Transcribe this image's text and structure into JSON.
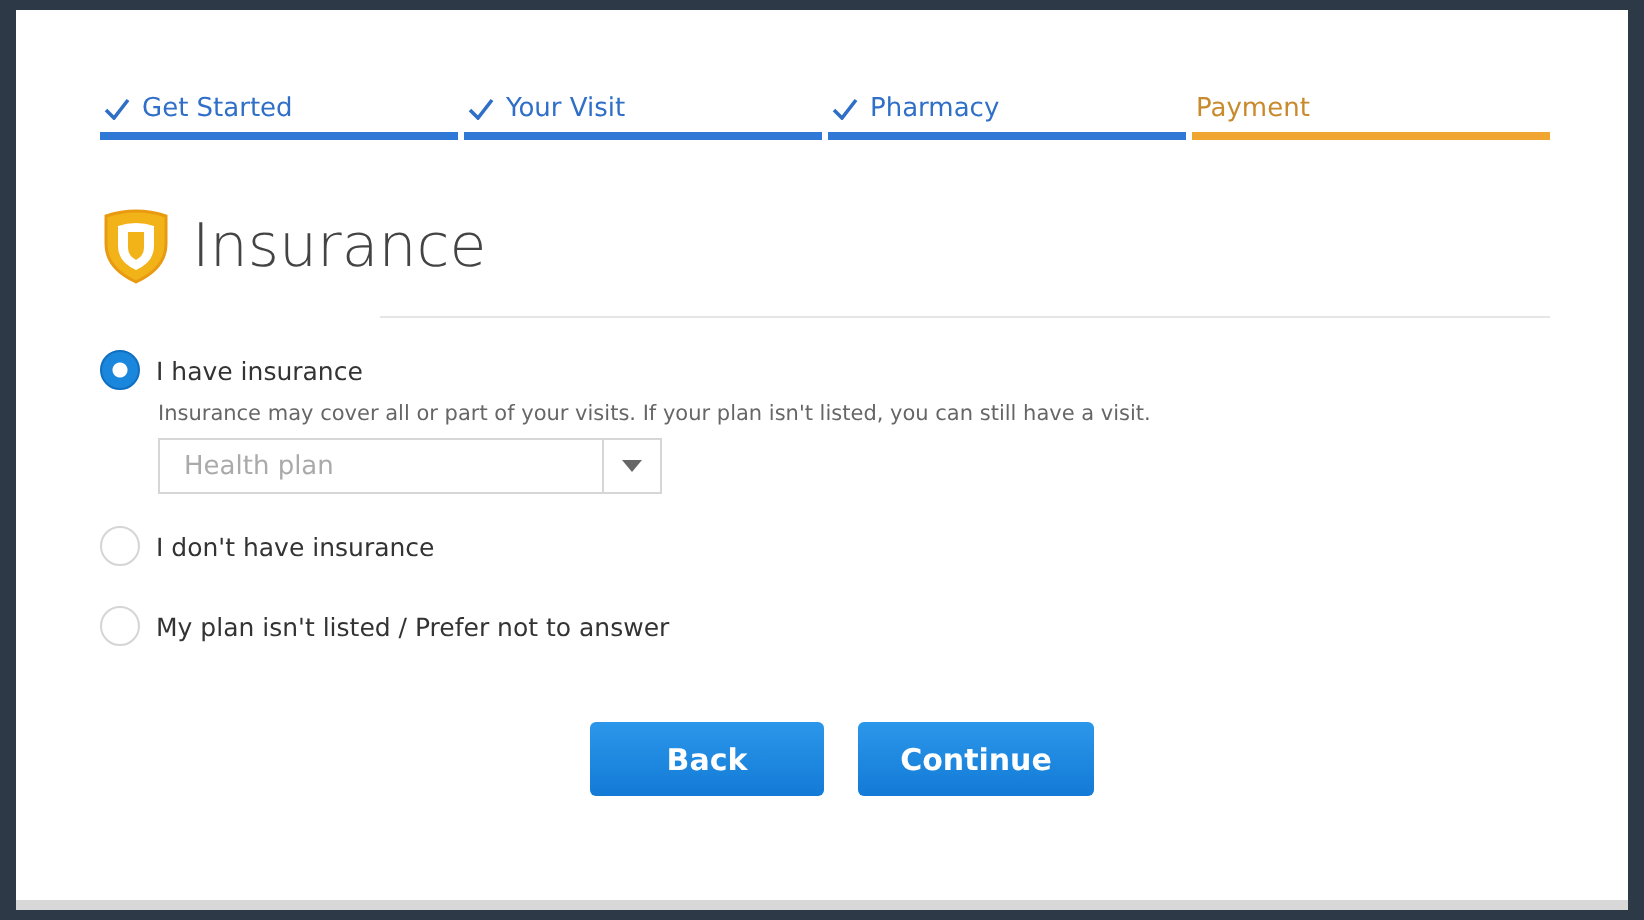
{
  "steps": [
    {
      "label": "Get Started",
      "completed": true,
      "selected": false
    },
    {
      "label": "Your Visit",
      "completed": true,
      "selected": false
    },
    {
      "label": "Pharmacy",
      "completed": true,
      "selected": false
    },
    {
      "label": "Payment",
      "completed": false,
      "selected": true
    }
  ],
  "heading": "Insurance",
  "options": [
    {
      "label": "I have insurance",
      "selected": true,
      "description": "Insurance may cover all or part of your visits. If your plan isn't listed, you can still have a visit.",
      "dropdown": {
        "placeholder": "Health plan"
      }
    },
    {
      "label": "I don't have insurance",
      "selected": false
    },
    {
      "label": "My plan isn't listed / Prefer not to answer",
      "selected": false
    }
  ],
  "buttons": [
    "Back",
    "Continue"
  ]
}
